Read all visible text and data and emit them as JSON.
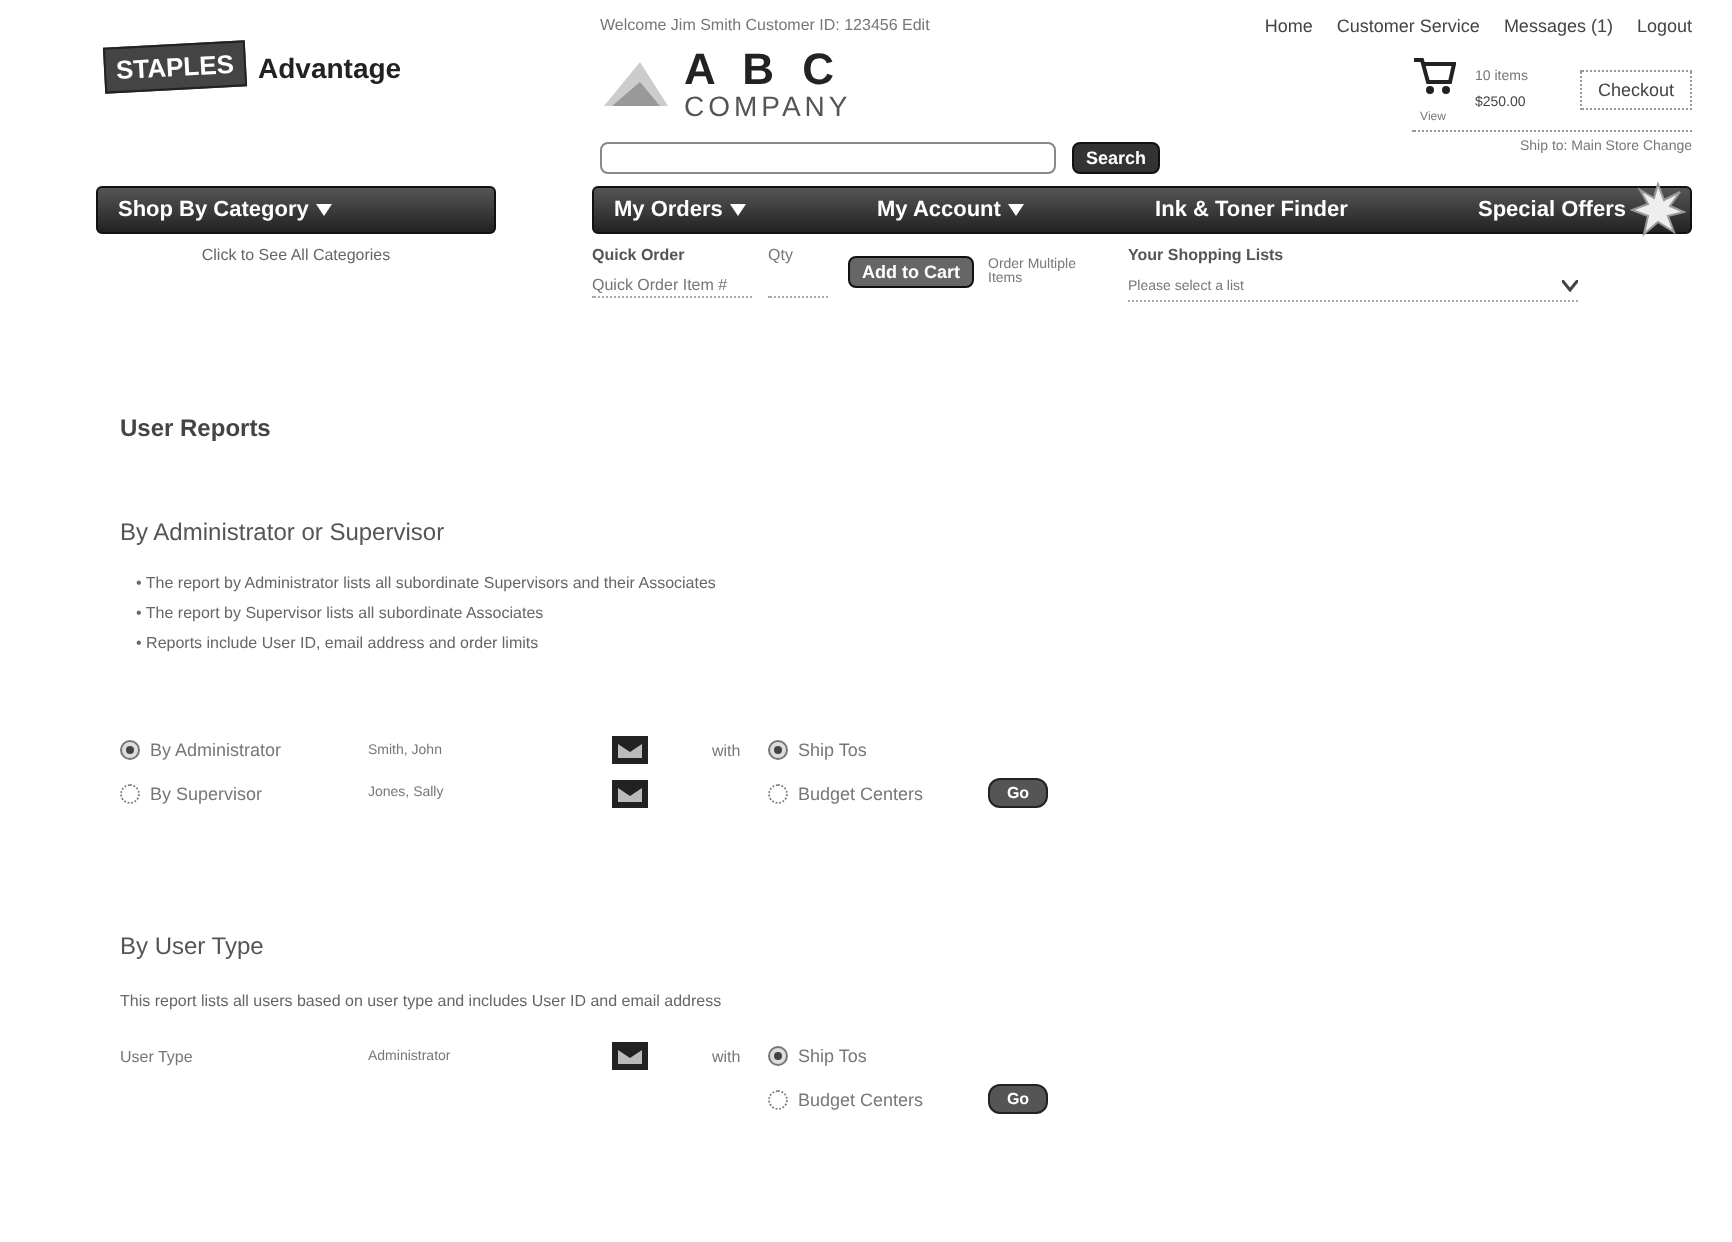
{
  "header": {
    "logo_brand": "STAPLES",
    "logo_name": "Advantage",
    "welcome": "Welcome Jim Smith   Customer ID: 123456 Edit",
    "company_letters": "A B C",
    "company_word": "COMPANY",
    "top_links": [
      "Home",
      "Customer Service",
      "Messages (1)",
      "Logout"
    ],
    "cart": {
      "count": "10 items",
      "total": "$250.00",
      "view": "View"
    },
    "checkout": "Checkout",
    "ship_to": "Ship to: Main Store Change",
    "search_button": "Search"
  },
  "nav": [
    {
      "label": "Shop By Category",
      "kind": "menu"
    },
    {
      "label": "My Orders",
      "kind": "menu"
    },
    {
      "label": "My Account",
      "kind": "menu"
    },
    {
      "label": "Ink & Toner Finder",
      "kind": "link"
    },
    {
      "label": "Special Offers",
      "kind": "offer"
    }
  ],
  "categories_link": "Click to See All Categories",
  "quick_order": {
    "title": "Quick Order",
    "qty_label": "Qty",
    "item_placeholder": "Quick Order Item #",
    "add_button": "Add to Cart",
    "multiple_link": "Order Multiple Items"
  },
  "shopping_lists": {
    "title": "Your Shopping Lists",
    "placeholder": "Please select a list"
  },
  "page_title": "User Reports",
  "admin_section": {
    "title": "By Administrator or Supervisor",
    "bullet_mark": "•",
    "bullets": [
      "The report by Administrator lists all subordinate Supervisors and their Associates",
      "The report by Supervisor lists all subordinate Associates",
      "Reports include User ID, email address and order limits"
    ],
    "rows": [
      {
        "label": "By Administrator",
        "value": "Smith, John",
        "selected": true
      },
      {
        "label": "By Supervisor",
        "value": "Jones, Sally",
        "selected": false
      }
    ],
    "with_label": "with",
    "options": [
      {
        "label": "Ship Tos",
        "selected": true
      },
      {
        "label": "Budget Centers",
        "selected": false
      }
    ],
    "go": "Go"
  },
  "type_section": {
    "title": "By User Type",
    "description": "This report lists all users based on user type and includes User ID and email address",
    "field_label": "User Type",
    "value": "Administrator",
    "with_label": "with",
    "options": [
      {
        "label": "Ship Tos",
        "selected": true
      },
      {
        "label": "Budget Centers",
        "selected": false
      }
    ],
    "go": "Go"
  }
}
